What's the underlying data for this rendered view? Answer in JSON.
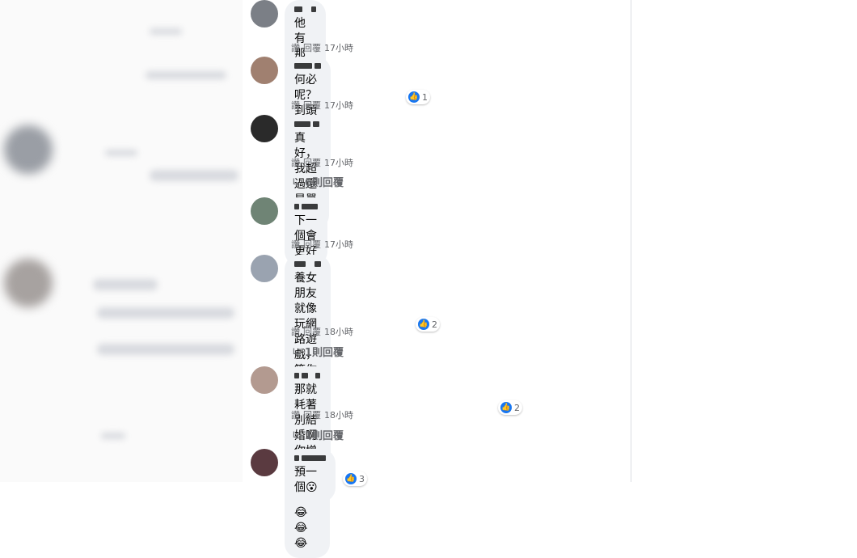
{
  "comments": [
    {
      "text": "他有那個價值嗎",
      "meta": [
        "讚",
        "回覆",
        "17小時"
      ]
    },
    {
      "text": "何必呢？到頭來 啥也不是",
      "meta": [
        "讚",
        "回覆",
        "17小時"
      ],
      "likes": "1"
    },
    {
      "text": "真好，我超過還是單身...",
      "meta": [
        "讚",
        "回覆",
        "17小時"
      ],
      "replies": "6則回覆"
    },
    {
      "text": "下一個會更好",
      "meta": [
        "讚",
        "回覆",
        "17小時"
      ]
    },
    {
      "text": "養女朋友就像玩網路遊戲，\n等你把她養大尾之後....\n就被盜帳號了！",
      "meta": [
        "讚",
        "回覆",
        "18小時"
      ],
      "likes": "2",
      "replies": "1則回覆"
    },
    {
      "text": "那就耗著別結婚啊 你增值他掉價😂😂😂😂",
      "meta": [
        "讚",
        "回覆",
        "18小時"
      ],
      "likes": "2",
      "replies": "1則回覆"
    },
    {
      "text": "預一個😮",
      "likes": "3"
    }
  ],
  "colors": {
    "like": "#1877f2",
    "bubble": "#f0f2f5",
    "meta": "#65676b"
  }
}
